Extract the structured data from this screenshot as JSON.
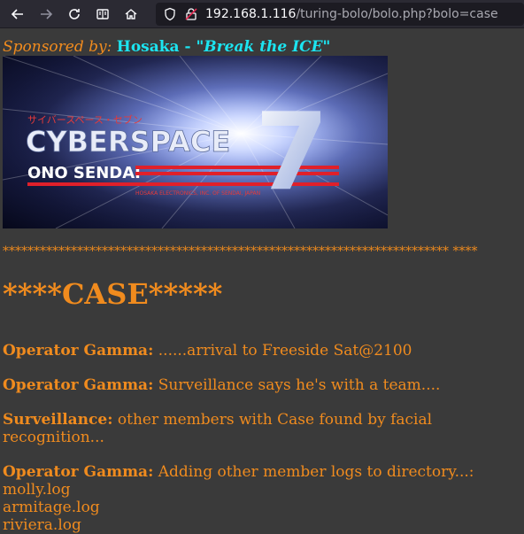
{
  "browser": {
    "url_host": "192.168.1.116",
    "url_path": "/turing-bolo/bolo.php?bolo=case",
    "icons": [
      "back-icon",
      "forward-icon",
      "reload-icon",
      "reader-view-icon",
      "home-icon",
      "shield-icon",
      "insecure-lock-icon"
    ]
  },
  "sponsor": {
    "label": "Sponsored by:",
    "name": "Hosaka - ",
    "quote": "\"Break the ICE\""
  },
  "banner": {
    "katakana": "サイバースペース・セブン",
    "line1": "CYBERSPACE",
    "line2": "ONO SENDAI",
    "numeral": "7",
    "fineprint": "HOSAKA ELECTRONICS, INC. OF SENDAI, JAPAN"
  },
  "divider": "************************************************************************ ****",
  "title": "****CASE*****",
  "entries": [
    {
      "speaker": "Operator Gamma:",
      "text": " ......arrival to Freeside Sat@2100"
    },
    {
      "speaker": "Operator Gamma:",
      "text": " Surveillance says he's with a team...."
    },
    {
      "speaker": "Surveillance:",
      "text": " other members with Case found by facial recognition..."
    },
    {
      "speaker": "Operator Gamma:",
      "text": " Adding other member logs to directory...:"
    }
  ],
  "files": [
    "molly.log",
    "armitage.log",
    "riviera.log"
  ],
  "colors": {
    "background": "#3a3a3a",
    "text": "#f08b1e",
    "sponsor_accent": "#1ce4f0",
    "toolbar": "#2b2a33"
  }
}
